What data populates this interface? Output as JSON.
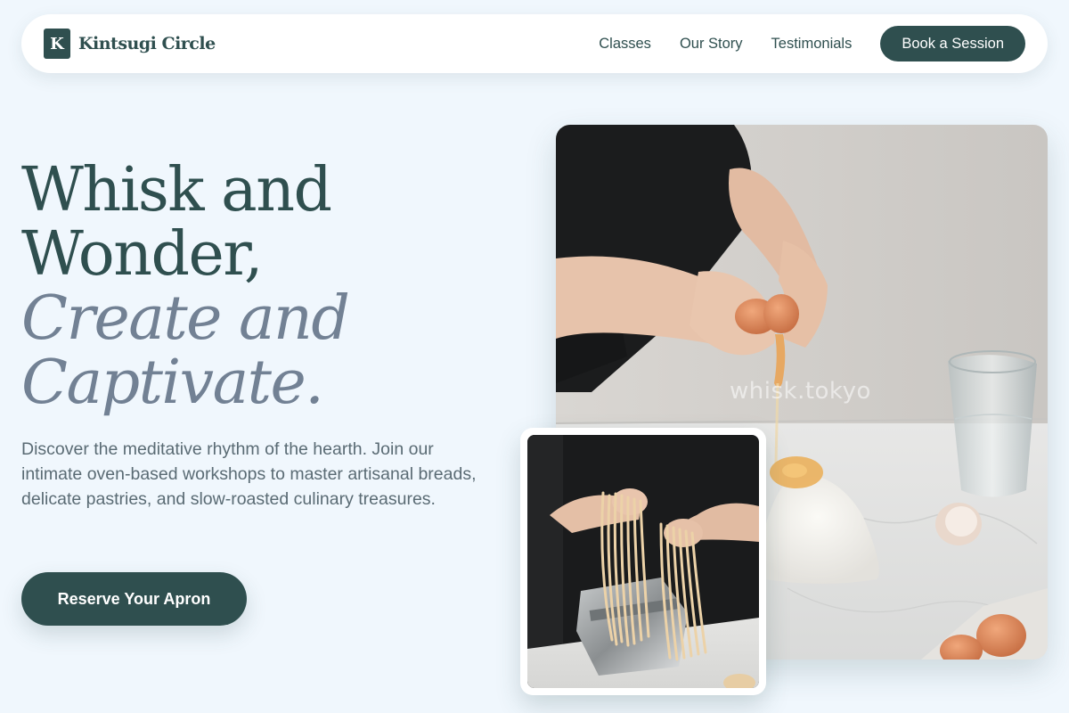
{
  "nav": {
    "logo_letter": "K",
    "brand": "Kintsugi Circle",
    "links": [
      "Classes",
      "Our Story",
      "Testimonials"
    ],
    "cta": "Book a Session"
  },
  "hero": {
    "title_line1": "Whisk and",
    "title_line2": "Wonder,",
    "title_line3": "Create and",
    "title_line4": "Captivate.",
    "description": "Discover the meditative rhythm of the hearth. Join our intimate oven-based workshops to master artisanal breads, delicate pastries, and slow-roasted culinary treasures.",
    "cta": "Reserve Your Apron"
  },
  "images": {
    "main_watermark": "whisk.tokyo"
  },
  "colors": {
    "primary": "#2f4f4f",
    "accent_italic": "#728194",
    "background": "#f0f7fd"
  }
}
